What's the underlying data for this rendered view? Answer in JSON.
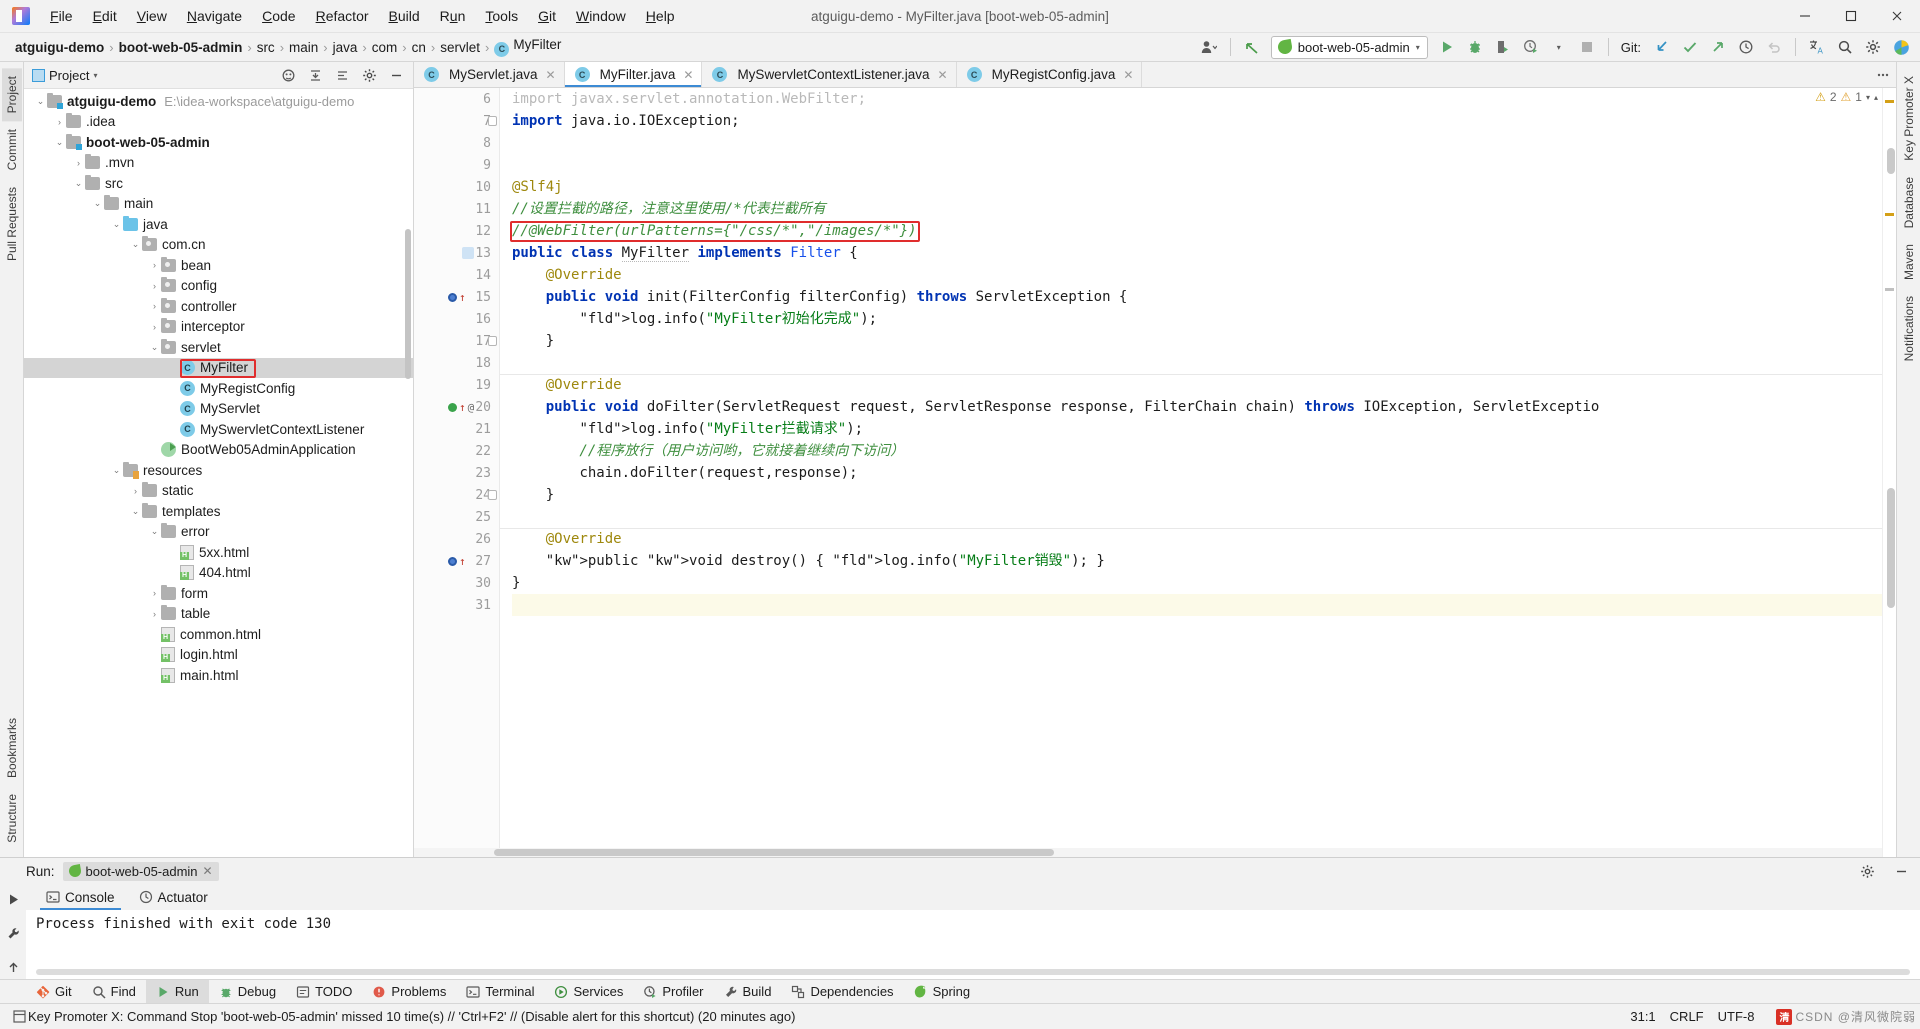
{
  "window": {
    "title": "atguigu-demo - MyFilter.java [boot-web-05-admin]",
    "minimize": "—",
    "maximize": "❐",
    "close": "✕"
  },
  "menu": {
    "items": [
      "File",
      "Edit",
      "View",
      "Navigate",
      "Code",
      "Refactor",
      "Build",
      "Run",
      "Tools",
      "Git",
      "Window",
      "Help"
    ]
  },
  "breadcrumb": {
    "items": [
      "atguigu-demo",
      "boot-web-05-admin",
      "src",
      "main",
      "java",
      "com",
      "cn",
      "servlet"
    ],
    "current": "MyFilter",
    "class_badge": "C",
    "separator": "›"
  },
  "toolbar": {
    "run_config": "boot-web-05-admin",
    "run_config_caret": "▾",
    "git_label": "Git:",
    "icons": {
      "account": "account-icon",
      "back": "back-arrow-icon",
      "run": "run-icon",
      "debug": "debug-icon",
      "run_coverage": "run-with-coverage-icon",
      "profiler": "profiler-icon",
      "stop": "stop-icon",
      "update": "git-update-icon",
      "commit": "git-commit-icon",
      "push": "git-push-icon",
      "history": "git-history-icon",
      "rollback": "git-rollback-icon",
      "translate": "translate-icon",
      "search": "search-everywhere-icon",
      "settings": "settings-icon",
      "plugin": "plugin-icon"
    }
  },
  "left_strip": {
    "tabs": [
      "Project",
      "Commit",
      "Pull Requests"
    ],
    "bottom_tabs": [
      "Bookmarks",
      "Structure"
    ]
  },
  "right_strip": {
    "tabs": [
      "Key Promoter X",
      "Database",
      "Maven",
      "Notifications"
    ]
  },
  "project_panel": {
    "title": "Project",
    "caret": "▾",
    "tree": [
      {
        "depth": 0,
        "arrow": "⌄",
        "icon": "folder-module",
        "label": "atguigu-demo",
        "bold": true,
        "path": "E:\\idea-workspace\\atguigu-demo"
      },
      {
        "depth": 1,
        "arrow": "›",
        "icon": "folder",
        "label": ".idea"
      },
      {
        "depth": 1,
        "arrow": "⌄",
        "icon": "folder-module",
        "label": "boot-web-05-admin",
        "bold": true
      },
      {
        "depth": 2,
        "arrow": "›",
        "icon": "folder",
        "label": ".mvn"
      },
      {
        "depth": 2,
        "arrow": "⌄",
        "icon": "folder",
        "label": "src"
      },
      {
        "depth": 3,
        "arrow": "⌄",
        "icon": "folder",
        "label": "main"
      },
      {
        "depth": 4,
        "arrow": "⌄",
        "icon": "folder-source",
        "label": "java"
      },
      {
        "depth": 5,
        "arrow": "⌄",
        "icon": "folder-package",
        "label": "com.cn"
      },
      {
        "depth": 6,
        "arrow": "›",
        "icon": "folder-package",
        "label": "bean"
      },
      {
        "depth": 6,
        "arrow": "›",
        "icon": "folder-package",
        "label": "config"
      },
      {
        "depth": 6,
        "arrow": "›",
        "icon": "folder-package",
        "label": "controller"
      },
      {
        "depth": 6,
        "arrow": "›",
        "icon": "folder-package",
        "label": "interceptor"
      },
      {
        "depth": 6,
        "arrow": "⌄",
        "icon": "folder-package",
        "label": "servlet"
      },
      {
        "depth": 7,
        "arrow": "",
        "icon": "java-class",
        "label": "MyFilter",
        "selected": true,
        "highlight": true
      },
      {
        "depth": 7,
        "arrow": "",
        "icon": "java-class",
        "label": "MyRegistConfig"
      },
      {
        "depth": 7,
        "arrow": "",
        "icon": "java-class",
        "label": "MyServlet"
      },
      {
        "depth": 7,
        "arrow": "",
        "icon": "java-class",
        "label": "MySwervletContextListener"
      },
      {
        "depth": 6,
        "arrow": "",
        "icon": "spring-boot-class",
        "label": "BootWeb05AdminApplication"
      },
      {
        "depth": 4,
        "arrow": "⌄",
        "icon": "folder-resources",
        "label": "resources"
      },
      {
        "depth": 5,
        "arrow": "›",
        "icon": "folder",
        "label": "static"
      },
      {
        "depth": 5,
        "arrow": "⌄",
        "icon": "folder",
        "label": "templates"
      },
      {
        "depth": 6,
        "arrow": "⌄",
        "icon": "folder",
        "label": "error"
      },
      {
        "depth": 7,
        "arrow": "",
        "icon": "html-file",
        "label": "5xx.html"
      },
      {
        "depth": 7,
        "arrow": "",
        "icon": "html-file",
        "label": "404.html"
      },
      {
        "depth": 6,
        "arrow": "›",
        "icon": "folder",
        "label": "form"
      },
      {
        "depth": 6,
        "arrow": "›",
        "icon": "folder",
        "label": "table"
      },
      {
        "depth": 6,
        "arrow": "",
        "icon": "html-file",
        "label": "common.html"
      },
      {
        "depth": 6,
        "arrow": "",
        "icon": "html-file",
        "label": "login.html"
      },
      {
        "depth": 6,
        "arrow": "",
        "icon": "html-file",
        "label": "main.html"
      }
    ]
  },
  "editor": {
    "tabs": [
      {
        "label": "MyServlet.java",
        "active": false,
        "close": "✕"
      },
      {
        "label": "MyFilter.java",
        "active": true,
        "close": "✕"
      },
      {
        "label": "MySwervletContextListener.java",
        "active": false,
        "close": "✕"
      },
      {
        "label": "MyRegistConfig.java",
        "active": false,
        "close": "✕"
      }
    ],
    "inspection": {
      "warnings": "2",
      "weak_warnings": "1",
      "warn_symbol": "⚠"
    },
    "lines": [
      {
        "num": "6",
        "gutter": "",
        "text": "import javax.servlet.annotation.WebFilter;",
        "kind": "import-faded"
      },
      {
        "num": "7",
        "gutter": "fold",
        "text": "import java.io.IOException;",
        "kind": "import"
      },
      {
        "num": "8",
        "gutter": "",
        "text": ""
      },
      {
        "num": "9",
        "gutter": "",
        "text": ""
      },
      {
        "num": "10",
        "gutter": "",
        "text": "@Slf4j",
        "kind": "annotation"
      },
      {
        "num": "11",
        "gutter": "",
        "text": "//设置拦截的路径，注意这里使用/*代表拦截所有",
        "kind": "comment"
      },
      {
        "num": "12",
        "gutter": "",
        "text": "//@WebFilter(urlPatterns={\"/css/*\",\"/images/*\"})",
        "kind": "comment",
        "redbox": true
      },
      {
        "num": "13",
        "gutter": "spring",
        "text": "public class MyFilter implements Filter {",
        "kind": "class-decl"
      },
      {
        "num": "14",
        "gutter": "",
        "text": "    @Override",
        "kind": "annotation"
      },
      {
        "num": "15",
        "gutter": "bp-run",
        "text": "    public void init(FilterConfig filterConfig) throws ServletException {",
        "kind": "method"
      },
      {
        "num": "16",
        "gutter": "",
        "text": "        log.info(\"MyFilter初始化完成\");",
        "kind": "log"
      },
      {
        "num": "17",
        "gutter": "fold",
        "text": "    }"
      },
      {
        "num": "18",
        "gutter": "",
        "text": ""
      },
      {
        "num": "19",
        "gutter": "",
        "text": "    @Override",
        "kind": "annotation"
      },
      {
        "num": "20",
        "gutter": "bp-run-at",
        "text": "    public void doFilter(ServletRequest request, ServletResponse response, FilterChain chain) throws IOException, ServletExceptio",
        "kind": "method"
      },
      {
        "num": "21",
        "gutter": "",
        "text": "        log.info(\"MyFilter拦截请求\");",
        "kind": "log"
      },
      {
        "num": "22",
        "gutter": "",
        "text": "        //程序放行（用户访问哟，它就接着继续向下访问）",
        "kind": "comment"
      },
      {
        "num": "23",
        "gutter": "",
        "text": "        chain.doFilter(request,response);",
        "kind": "chain"
      },
      {
        "num": "24",
        "gutter": "fold",
        "text": "    }"
      },
      {
        "num": "25",
        "gutter": "",
        "text": ""
      },
      {
        "num": "26",
        "gutter": "",
        "text": "    @Override",
        "kind": "annotation"
      },
      {
        "num": "27",
        "gutter": "bp-run",
        "text": "    public void destroy() { log.info(\"MyFilter销毁\"); }",
        "kind": "destroy"
      },
      {
        "num": "30",
        "gutter": "",
        "text": "}"
      },
      {
        "num": "31",
        "gutter": "",
        "text": "",
        "current": true
      }
    ]
  },
  "run_window": {
    "label": "Run:",
    "config_chip": "boot-web-05-admin",
    "chip_close": "✕",
    "tabs": [
      {
        "label": "Console",
        "icon": "console-icon",
        "active": true
      },
      {
        "label": "Actuator",
        "icon": "actuator-icon",
        "active": false
      }
    ],
    "console_output": "Process finished with exit code 130",
    "settings_icon": "gear-icon",
    "hide_icon": "hide-icon"
  },
  "bottom_toolbar": {
    "items": [
      {
        "label": "Git",
        "icon": "git-icon",
        "active": false
      },
      {
        "label": "Find",
        "icon": "find-icon",
        "active": false
      },
      {
        "label": "Run",
        "icon": "run-icon",
        "active": true
      },
      {
        "label": "Debug",
        "icon": "debug-icon",
        "active": false
      },
      {
        "label": "TODO",
        "icon": "todo-icon",
        "active": false
      },
      {
        "label": "Problems",
        "icon": "problems-icon",
        "active": false
      },
      {
        "label": "Terminal",
        "icon": "terminal-icon",
        "active": false
      },
      {
        "label": "Services",
        "icon": "services-icon",
        "active": false
      },
      {
        "label": "Profiler",
        "icon": "profiler-icon",
        "active": false
      },
      {
        "label": "Build",
        "icon": "build-icon",
        "active": false
      },
      {
        "label": "Dependencies",
        "icon": "dependencies-icon",
        "active": false
      },
      {
        "label": "Spring",
        "icon": "spring-icon",
        "active": false
      }
    ]
  },
  "statusbar": {
    "message": "Key Promoter X: Command Stop 'boot-web-05-admin' missed 10 time(s) // 'Ctrl+F2' // (Disable alert for this shortcut) (20 minutes ago)",
    "position": "31:1",
    "line_separator": "CRLF",
    "encoding": "UTF-8",
    "watermark_badge": "清",
    "watermark_text": "CSDN @清风微院弱"
  }
}
